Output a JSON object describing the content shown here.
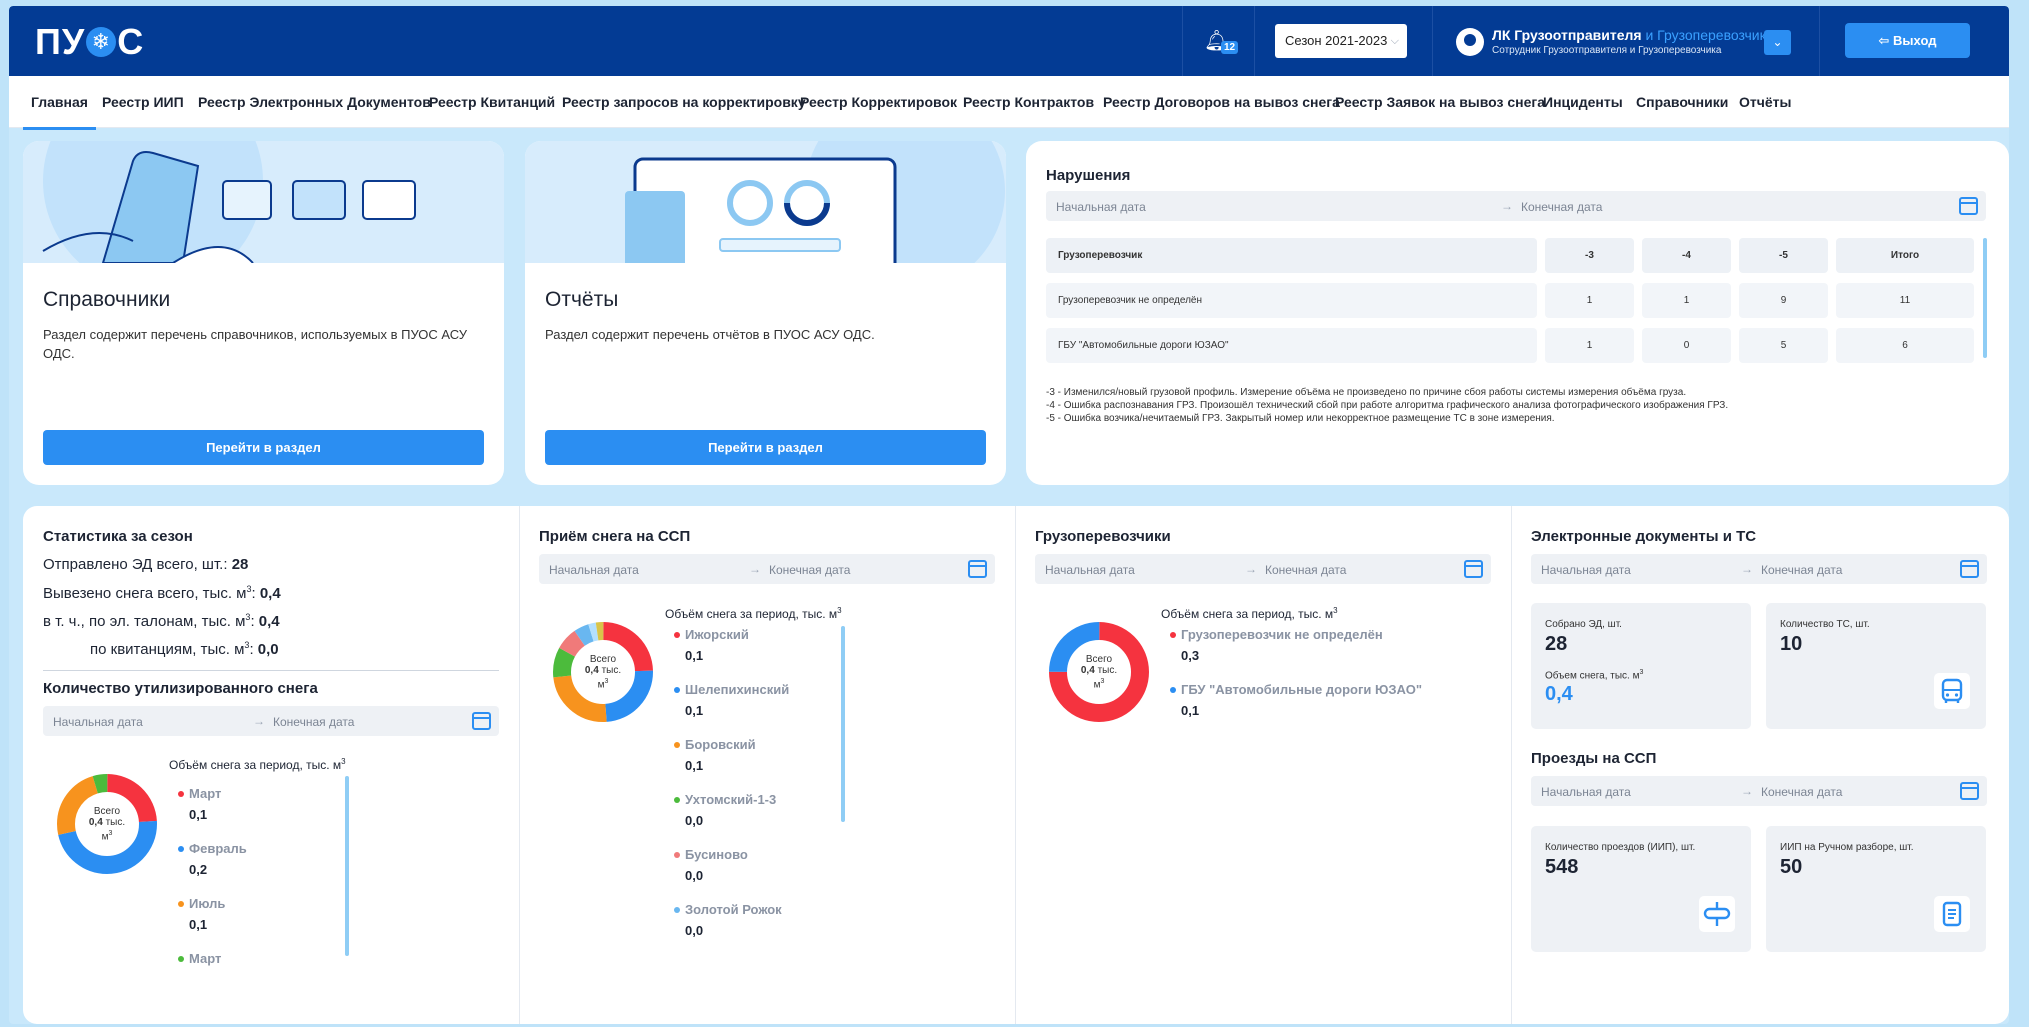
{
  "header": {
    "logo_text": [
      "ПУ",
      "С"
    ],
    "notifications_count": "12",
    "season": "Сезон 2021-2023",
    "user_name": "ЛК Грузоотправителя",
    "user_name_extra": "и Грузоперевозчика",
    "user_role": "Сотрудник Грузоотправителя и Грузоперевозчика",
    "logout": "Выход"
  },
  "nav": [
    "Главная",
    "Реестр ИИП",
    "Реестр Электронных Документов",
    "Реестр Квитанций",
    "Реестр запросов на корректировку",
    "Реестр Корректировок",
    "Реестр Контрактов",
    "Реестр Договоров на вывоз снега",
    "Реестр Заявок на вывоз снега",
    "Инциденты",
    "Справочники",
    "Отчёты"
  ],
  "cards": {
    "refs": {
      "title": "Справочники",
      "desc": "Раздел содержит перечень справочников, используемых в ПУОС АСУ ОДС.",
      "button": "Перейти в раздел"
    },
    "reports": {
      "title": "Отчёты",
      "desc": "Раздел содержит перечень отчётов в ПУОС АСУ ОДС.",
      "button": "Перейти в раздел"
    }
  },
  "date_range": {
    "start": "Начальная дата",
    "end": "Конечная дата"
  },
  "violations": {
    "title": "Нарушения",
    "columns": [
      "Грузоперевозчик",
      "-3",
      "-4",
      "-5",
      "Итого"
    ],
    "rows": [
      [
        "Грузоперевозчик не определён",
        "1",
        "1",
        "9",
        "11"
      ],
      [
        "ГБУ \"Автомобильные дороги ЮЗАО\"",
        "1",
        "0",
        "5",
        "6"
      ]
    ],
    "notes": [
      "-3 - Изменился/новый грузовой профиль. Измерение объёма не произведено по причине сбоя работы системы измерения объёма груза.",
      "-4 - Ошибка распознавания ГРЗ. Произошёл технический сбой при работе алгоритма графического анализа фотографического изображения ГРЗ.",
      "-5 - Ошибка возчика/нечитаемый ГРЗ. Закрытый номер или некорректное размещение ТС в зоне измерения."
    ]
  },
  "season_stats": {
    "title": "Статистика за сезон",
    "sent_label": "Отправлено ЭД всего, шт.:",
    "sent_value": "28",
    "snow_label": "Вывезено снега всего, тыс. м",
    "snow_value": "0,4",
    "el_label": "в т. ч., по эл. талонам, тыс. м",
    "el_value": "0,4",
    "rec_label": "по квитанциям, тыс. м",
    "rec_value": "0,0"
  },
  "utilized": {
    "title": "Количество утилизированного снега",
    "subtitle": "Объём снега за период, тыс. м",
    "center": [
      "Всего",
      "0,4",
      "тыс.",
      "м"
    ],
    "items": [
      {
        "name": "Март",
        "value": "0,1",
        "color": "#f5333f"
      },
      {
        "name": "Февраль",
        "value": "0,2",
        "color": "#2b8ef2"
      },
      {
        "name": "Июль",
        "value": "0,1",
        "color": "#f7931e"
      },
      {
        "name": "Март",
        "value": "",
        "color": "#4cbb3c"
      }
    ]
  },
  "ssp_intake": {
    "title": "Приём снега на ССП",
    "subtitle": "Объём снега за период, тыс. м",
    "center": [
      "Всего",
      "0,4",
      "тыс.",
      "м"
    ],
    "items": [
      {
        "name": "Ижорский",
        "value": "0,1",
        "color": "#f5333f"
      },
      {
        "name": "Шелепихинский",
        "value": "0,1",
        "color": "#2b8ef2"
      },
      {
        "name": "Боровский",
        "value": "0,1",
        "color": "#f7931e"
      },
      {
        "name": "Ухтомский-1-3",
        "value": "0,0",
        "color": "#4cbb3c"
      },
      {
        "name": "Бусиново",
        "value": "0,0",
        "color": "#f07a7a"
      },
      {
        "name": "Золотой Рожок",
        "value": "0,0",
        "color": "#69b7f0"
      }
    ]
  },
  "carriers": {
    "title": "Грузоперевозчики",
    "subtitle": "Объём снега за период, тыс. м",
    "center": [
      "Всего",
      "0,4",
      "тыс.",
      "м"
    ],
    "items": [
      {
        "name": "Грузоперевозчик не определён",
        "value": "0,3",
        "color": "#f5333f"
      },
      {
        "name": "ГБУ \"Автомобильные дороги ЮЗАО\"",
        "value": "0,1",
        "color": "#2b8ef2"
      }
    ]
  },
  "edocs": {
    "title": "Электронные документы и ТС",
    "collected_label": "Собрано ЭД, шт.",
    "collected_value": "28",
    "volume_label": "Объем снега, тыс. м",
    "volume_value": "0,4",
    "vehicles_label": "Количество ТС, шт.",
    "vehicles_value": "10"
  },
  "passes": {
    "title": "Проезды на ССП",
    "count_label": "Количество проездов (ИИП), шт.",
    "count_value": "548",
    "manual_label": "ИИП на Ручном разборе, шт.",
    "manual_value": "50"
  }
}
